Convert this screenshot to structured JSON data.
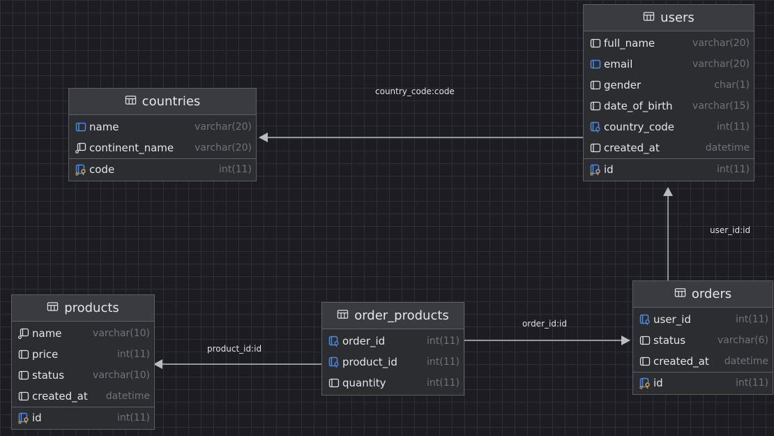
{
  "colors": {
    "background": "#1c1c22",
    "grid": "#2e2f36",
    "table_bg": "#2b2d30",
    "table_header_bg": "#393b40",
    "border": "#5b5e64",
    "text": "#dfe1e5",
    "type_text": "#6f737a",
    "key_blue": "#4e88e0",
    "key_yellow": "#d6a243",
    "edge": "#b8bbc0"
  },
  "tables": [
    {
      "id": "users",
      "name": "users",
      "columns": [
        {
          "name": "full_name",
          "type": "varchar(20)",
          "icon": "column-icon"
        },
        {
          "name": "email",
          "type": "varchar(20)",
          "icon": "indexed-column-icon"
        },
        {
          "name": "gender",
          "type": "char(1)",
          "icon": "column-icon"
        },
        {
          "name": "date_of_birth",
          "type": "varchar(15)",
          "icon": "column-icon"
        },
        {
          "name": "country_code",
          "type": "int(11)",
          "icon": "foreign-key-icon"
        },
        {
          "name": "created_at",
          "type": "datetime",
          "icon": "column-icon"
        },
        {
          "name": "id",
          "type": "int(11)",
          "icon": "primary-key-icon",
          "pk": true
        }
      ]
    },
    {
      "id": "countries",
      "name": "countries",
      "columns": [
        {
          "name": "name",
          "type": "varchar(20)",
          "icon": "indexed-column-icon"
        },
        {
          "name": "continent_name",
          "type": "varchar(20)",
          "icon": "not-null-column-icon"
        },
        {
          "name": "code",
          "type": "int(11)",
          "icon": "primary-key-icon",
          "pk": true
        }
      ]
    },
    {
      "id": "products",
      "name": "products",
      "columns": [
        {
          "name": "name",
          "type": "varchar(10)",
          "icon": "not-null-column-icon"
        },
        {
          "name": "price",
          "type": "int(11)",
          "icon": "column-icon"
        },
        {
          "name": "status",
          "type": "varchar(10)",
          "icon": "column-icon"
        },
        {
          "name": "created_at",
          "type": "datetime",
          "icon": "column-icon"
        },
        {
          "name": "id",
          "type": "int(11)",
          "icon": "primary-key-icon",
          "pk": true
        }
      ]
    },
    {
      "id": "order_products",
      "name": "order_products",
      "columns": [
        {
          "name": "order_id",
          "type": "int(11)",
          "icon": "foreign-key-icon"
        },
        {
          "name": "product_id",
          "type": "int(11)",
          "icon": "foreign-key-icon"
        },
        {
          "name": "quantity",
          "type": "int(11)",
          "icon": "column-icon"
        }
      ]
    },
    {
      "id": "orders",
      "name": "orders",
      "columns": [
        {
          "name": "user_id",
          "type": "int(11)",
          "icon": "foreign-key-icon"
        },
        {
          "name": "status",
          "type": "varchar(6)",
          "icon": "column-icon"
        },
        {
          "name": "created_at",
          "type": "datetime",
          "icon": "column-icon"
        },
        {
          "name": "id",
          "type": "int(11)",
          "icon": "primary-key-icon",
          "pk": true
        }
      ]
    }
  ],
  "relations": [
    {
      "id": "users-countries",
      "label": "country_code:code"
    },
    {
      "id": "orders-users",
      "label": "user_id:id"
    },
    {
      "id": "order-products-orders",
      "label": "order_id:id"
    },
    {
      "id": "order-products-products",
      "label": "product_id:id"
    }
  ]
}
